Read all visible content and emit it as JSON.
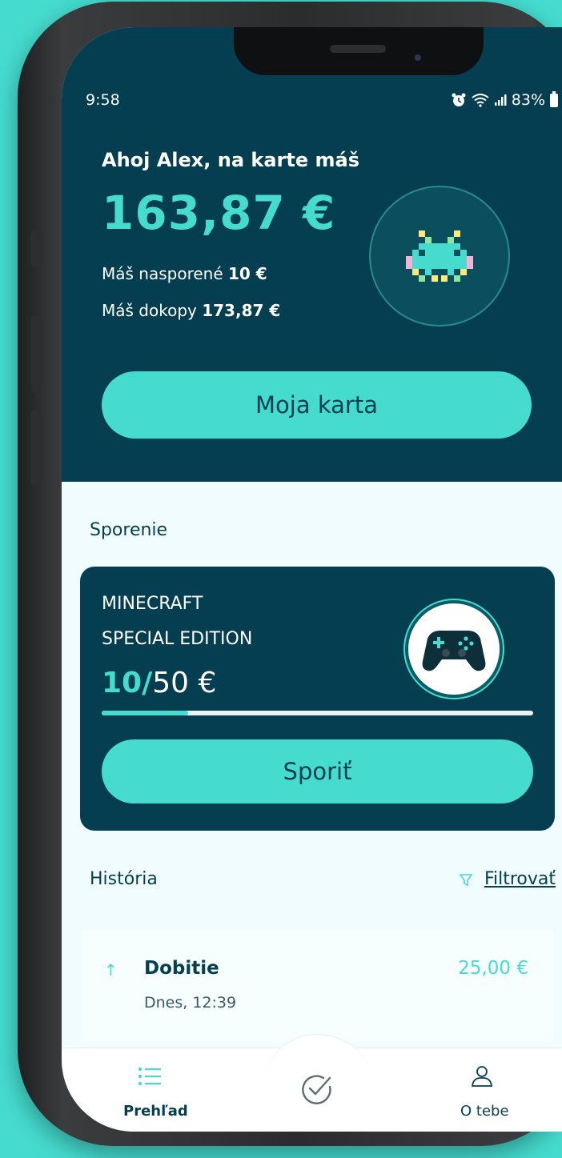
{
  "status_bar": {
    "time": "9:58",
    "battery": "83%"
  },
  "account": {
    "greeting": "Ahoj Alex, na karte máš",
    "balance": "163,87 €",
    "saved_prefix": "Máš nasporené",
    "saved_value": "10 €",
    "total_prefix": "Máš dokopy",
    "total_value": "173,87 €",
    "card_button": "Moja karta"
  },
  "saving": {
    "section_title": "Sporenie",
    "goal_line1": "MINECRAFT",
    "goal_line2": "SPECIAL EDITION",
    "current": "10",
    "separator": "/",
    "target": "50 €",
    "progress_fraction": 0.2,
    "save_button": "Sporiť"
  },
  "history": {
    "section_title": "História",
    "filter_label": "Filtrovať",
    "items": [
      {
        "title": "Dobitie",
        "subtitle": "Dnes, 12:39",
        "amount": "25,00 €",
        "direction": "up"
      }
    ]
  },
  "nav": {
    "left_label": "Prehľad",
    "right_label": "O tebe"
  },
  "colors": {
    "accent": "#45dccf",
    "dark": "#043e50",
    "background": "#f0fcfd"
  }
}
